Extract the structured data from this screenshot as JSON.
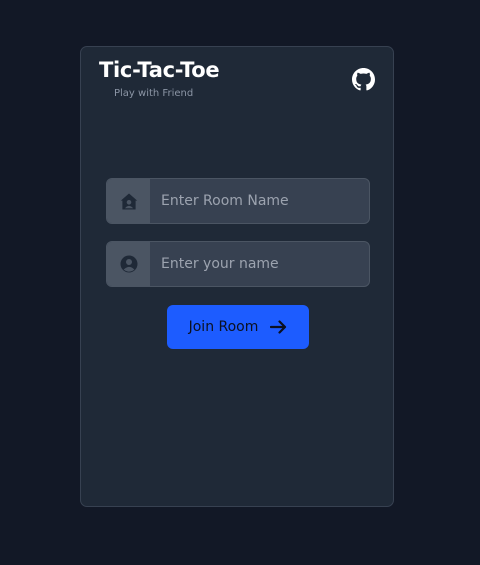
{
  "header": {
    "title": "Tic-Tac-Toe",
    "subtitle": "Play with Friend",
    "github_icon": "github-icon"
  },
  "form": {
    "room_field": {
      "placeholder": "Enter Room Name",
      "value": "",
      "icon": "house-user-icon"
    },
    "name_field": {
      "placeholder": "Enter your name",
      "value": "",
      "icon": "user-circle-icon"
    },
    "join_button": {
      "label": "Join Room",
      "icon": "arrow-right-icon"
    }
  },
  "colors": {
    "page_bg": "#121826",
    "card_bg": "#1f2937",
    "input_bg": "#374151",
    "icon_box_bg": "#4b5563",
    "accent": "#1d5cff"
  }
}
